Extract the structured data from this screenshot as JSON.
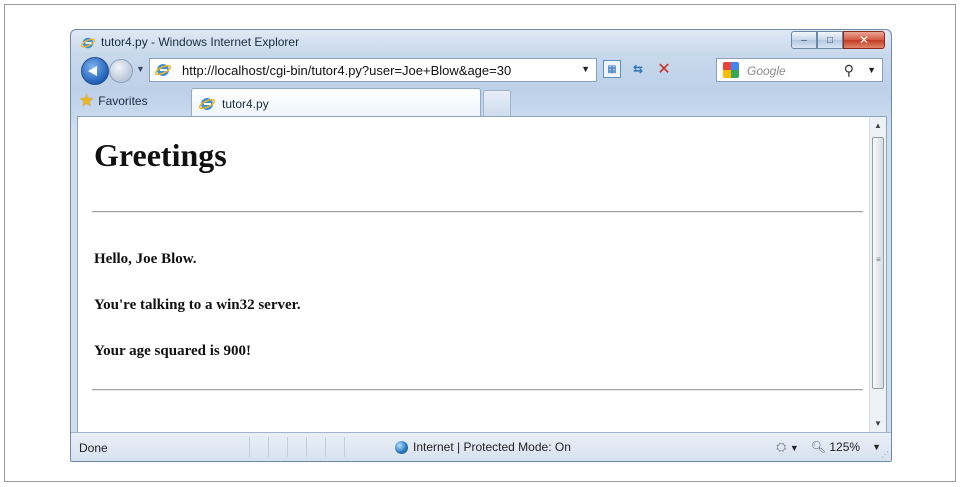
{
  "window": {
    "title": "tutor4.py - Windows Internet Explorer",
    "caption_minimize": "–",
    "caption_maximize": "□",
    "caption_close": "✕"
  },
  "address_bar": {
    "url": "http://localhost/cgi-bin/tutor4.py?user=Joe+Blow&age=30",
    "dropdown": "▼"
  },
  "search": {
    "placeholder": "Google",
    "icon": "search-icon",
    "dropdown": "▼"
  },
  "tabs": {
    "favorites_label": "Favorites",
    "active_tab_label": "tutor4.py"
  },
  "page": {
    "heading": "Greetings",
    "lines": [
      "Hello, Joe Blow.",
      "You're talking to a win32 server.",
      "Your age squared is 900!"
    ]
  },
  "status": {
    "text": "Done",
    "zone": "Internet | Protected Mode: On",
    "zoom": "125%"
  },
  "colors": {
    "chrome": "#bcd0e8",
    "close_button": "#c23c22",
    "brand_blue": "#1f5fb8"
  }
}
